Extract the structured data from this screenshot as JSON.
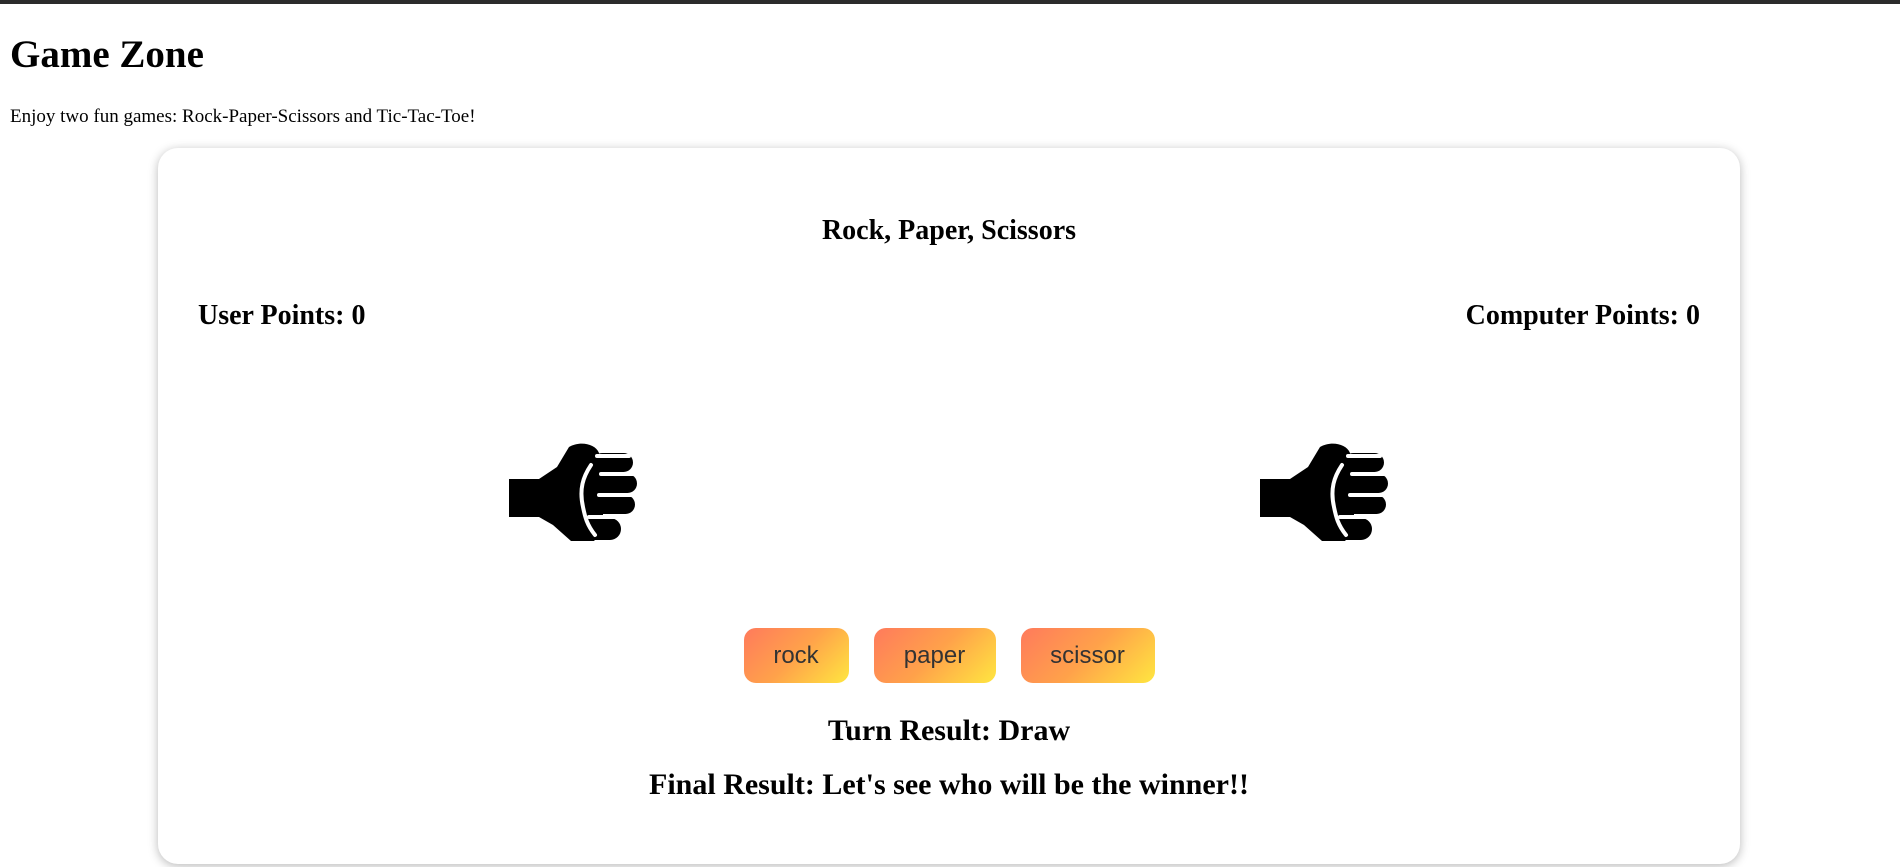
{
  "page": {
    "title": "Game Zone",
    "subtitle": "Enjoy two fun games: Rock-Paper-Scissors and Tic-Tac-Toe!"
  },
  "game": {
    "title": "Rock, Paper, Scissors",
    "user_points": "User Points: 0",
    "computer_points": "Computer Points: 0",
    "user_hand_icon": "fist-icon",
    "computer_hand_icon": "fist-icon",
    "choices": [
      "rock",
      "paper",
      "scissor"
    ],
    "turn_result": "Turn Result: Draw",
    "final_result": "Final Result: Let's see who will be the winner!!"
  },
  "colors": {
    "button_gradient_start": "#ff7a5c",
    "button_gradient_end": "#ffe640",
    "button_text": "#333333"
  }
}
